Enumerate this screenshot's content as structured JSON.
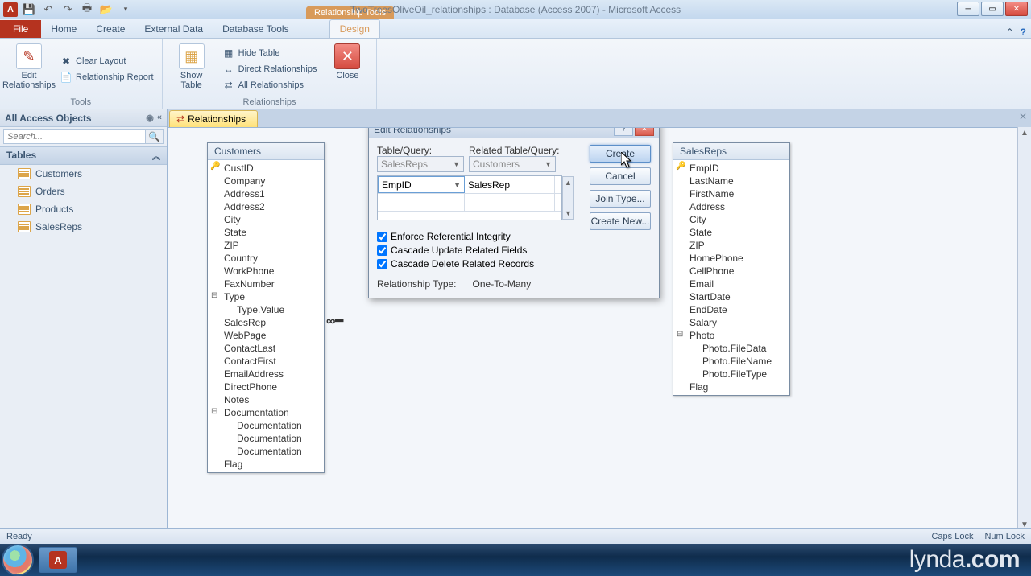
{
  "window": {
    "title": "TwoTreesOliveOil_relationships : Database (Access 2007)  -  Microsoft Access",
    "context_tab": "Relationship Tools"
  },
  "qat_icons": [
    "access-app-icon",
    "save-icon",
    "undo-icon",
    "redo-icon",
    "print-icon",
    "open-icon",
    "more-icon"
  ],
  "ribbon": {
    "tabs": [
      "File",
      "Home",
      "Create",
      "External Data",
      "Database Tools",
      "Design"
    ],
    "active_tab": "Design",
    "groups": {
      "tools": {
        "label": "Tools",
        "edit_relationships": "Edit\nRelationships",
        "clear_layout": "Clear Layout",
        "relationship_report": "Relationship Report"
      },
      "relationships": {
        "label": "Relationships",
        "show_table": "Show\nTable",
        "hide_table": "Hide Table",
        "direct_relationships": "Direct Relationships",
        "all_relationships": "All Relationships",
        "close": "Close"
      }
    }
  },
  "nav": {
    "header": "All Access Objects",
    "search_placeholder": "Search...",
    "group_label": "Tables",
    "items": [
      "Customers",
      "Orders",
      "Products",
      "SalesReps"
    ]
  },
  "doc_tab": "Relationships",
  "tables": {
    "customers": {
      "title": "Customers",
      "fields": [
        "CustID",
        "Company",
        "Address1",
        "Address2",
        "City",
        "State",
        "ZIP",
        "Country",
        "WorkPhone",
        "FaxNumber",
        "Type",
        "Type.Value",
        "SalesRep",
        "WebPage",
        "ContactLast",
        "ContactFirst",
        "EmailAddress",
        "DirectPhone",
        "Notes",
        "Documentation",
        "Documentation",
        "Documentation",
        "Documentation",
        "Flag"
      ],
      "key_index": 0,
      "exp_indices": [
        10,
        19
      ],
      "sub_indices": [
        11,
        20,
        21,
        22
      ]
    },
    "salesreps": {
      "title": "SalesReps",
      "fields": [
        "EmpID",
        "LastName",
        "FirstName",
        "Address",
        "City",
        "State",
        "ZIP",
        "HomePhone",
        "CellPhone",
        "Email",
        "StartDate",
        "EndDate",
        "Salary",
        "Photo",
        "Photo.FileData",
        "Photo.FileName",
        "Photo.FileType",
        "Flag"
      ],
      "key_index": 0,
      "exp_indices": [
        13
      ],
      "sub_indices": [
        14,
        15,
        16
      ]
    }
  },
  "dialog": {
    "title": "Edit Relationships",
    "table_query_label": "Table/Query:",
    "related_table_query_label": "Related Table/Query:",
    "table_value": "SalesReps",
    "related_value": "Customers",
    "map_left": "EmpID",
    "map_right": "SalesRep",
    "enforce": "Enforce Referential Integrity",
    "cascade_update": "Cascade Update Related Fields",
    "cascade_delete": "Cascade Delete Related Records",
    "rel_type_label": "Relationship Type:",
    "rel_type_value": "One-To-Many",
    "buttons": {
      "create": "Create",
      "cancel": "Cancel",
      "join_type": "Join Type...",
      "create_new": "Create New..."
    }
  },
  "status": {
    "left": "Ready",
    "caps": "Caps Lock",
    "num": "Num Lock"
  },
  "watermark": {
    "a": "lynda",
    "b": ".com"
  }
}
